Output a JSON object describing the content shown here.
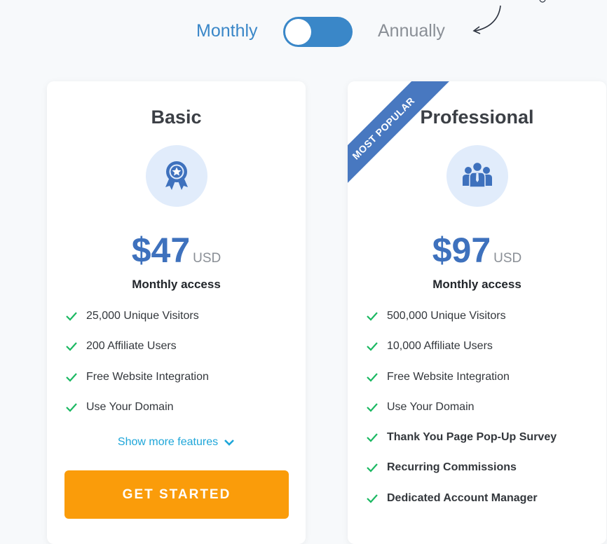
{
  "billing_toggle": {
    "monthly_label": "Monthly",
    "annually_label": "Annually",
    "selected": "Monthly"
  },
  "plans": [
    {
      "name": "Basic",
      "icon": "award-ribbon-icon",
      "price": "$47",
      "currency": "USD",
      "period": "Monthly access",
      "features": [
        "25,000 Unique Visitors",
        "200 Affiliate Users",
        "Free Website Integration",
        "Use Your Domain"
      ],
      "show_more": "Show more features",
      "cta": "GET STARTED"
    },
    {
      "name": "Professional",
      "badge": "MOST POPULAR",
      "icon": "team-users-icon",
      "price": "$97",
      "currency": "USD",
      "period": "Monthly access",
      "features": [
        "500,000 Unique Visitors",
        "10,000 Affiliate Users",
        "Free Website Integration",
        "Use Your Domain"
      ],
      "bold_features": [
        "Thank You Page Pop-Up Survey",
        "Recurring Commissions",
        "Dedicated Account Manager"
      ]
    }
  ],
  "colors": {
    "accent": "#3a87c8",
    "price": "#3e71bd",
    "check": "#1bb862",
    "cta": "#fa9c0a",
    "ribbon": "#4878c0"
  }
}
